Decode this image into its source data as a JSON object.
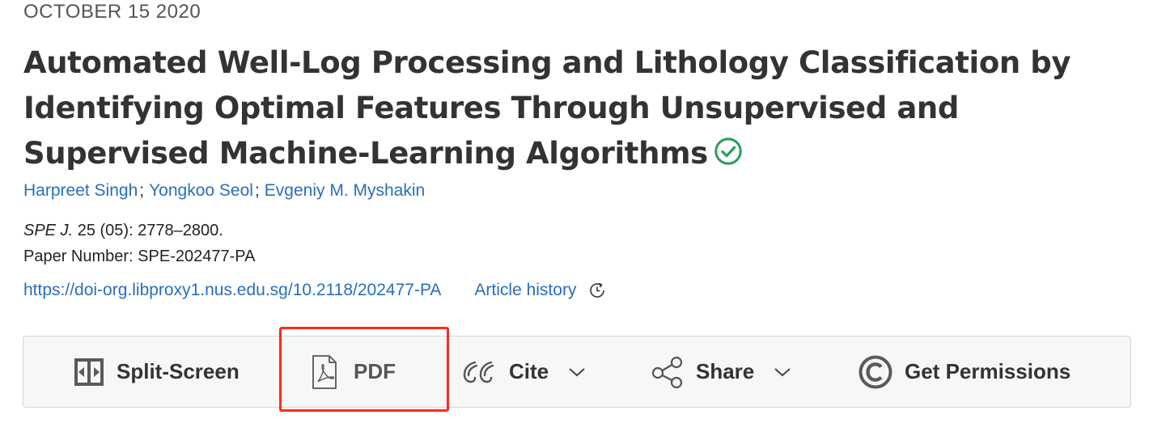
{
  "date": "OCTOBER 15 2020",
  "title": "Automated Well-Log Processing and Lithology Classification by Identifying Optimal Features Through Unsupervised and Supervised Machine-Learning Algorithms",
  "verified_icon": "check-circle-icon",
  "authors": [
    "Harpreet Singh",
    "Yongkoo Seol",
    "Evgeniy M. Myshakin"
  ],
  "author_separator": ";",
  "citation": {
    "journal": "SPE J.",
    "details": " 25 (05): 2778–2800.",
    "paper_number": "Paper Number: SPE-202477-PA"
  },
  "doi_link": "https://doi-org.libproxy1.nus.edu.sg/10.2118/202477-PA",
  "article_history": "Article history",
  "toolbar": {
    "split_screen": "Split-Screen",
    "pdf": "PDF",
    "cite": "Cite",
    "share": "Share",
    "get_permissions": "Get Permissions"
  },
  "colors": {
    "link": "#2a6ebb",
    "verified": "#2e9e5b",
    "highlight": "#ff2a1a",
    "toolbar_bg": "#f7f7f7"
  }
}
